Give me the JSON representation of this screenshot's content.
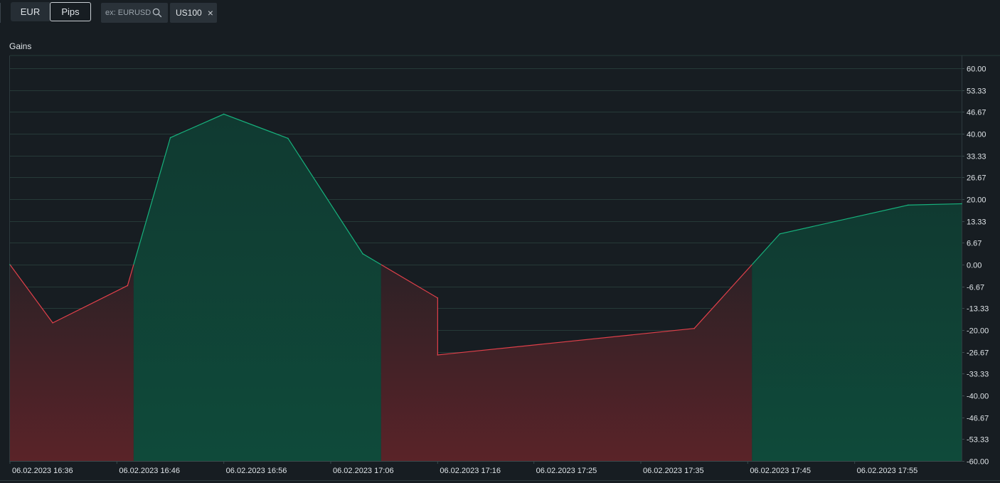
{
  "toolbar": {
    "units": [
      "EUR",
      "Pips"
    ],
    "selected_unit": "Pips",
    "search": {
      "placeholder": "ex: EURUSD",
      "value": ""
    },
    "tag": {
      "label": "US100",
      "close": "×"
    }
  },
  "colors": {
    "background": "#171d22",
    "positive_line": "#17b27d",
    "negative_line": "#e0404a",
    "grid": "#263a38"
  },
  "chart_data": {
    "type": "area",
    "title": "Gains",
    "xlabel": "",
    "ylabel": "",
    "ylim": [
      -60,
      60
    ],
    "y_ticks": [
      "60.00",
      "53.33",
      "46.67",
      "40.00",
      "33.33",
      "26.67",
      "20.00",
      "13.33",
      "6.67",
      "0.00",
      "-6.67",
      "-13.33",
      "-20.00",
      "-26.67",
      "-33.33",
      "-40.00",
      "-46.67",
      "-53.33",
      "-60.00"
    ],
    "x_ticks": [
      "06.02.2023 16:36",
      "06.02.2023 16:46",
      "06.02.2023 16:56",
      "06.02.2023 17:06",
      "06.02.2023 17:16",
      "06.02.2023 17:25",
      "06.02.2023 17:35",
      "06.02.2023 17:45",
      "06.02.2023 17:55"
    ],
    "x_range": [
      "06.02.2023 16:36",
      "06.02.2023 18:05"
    ],
    "grid": true,
    "positive_color": "#17b27d",
    "negative_color": "#e0404a",
    "series": [
      {
        "points": [
          {
            "x": "06.02.2023 16:36",
            "y": 0.0
          },
          {
            "x": "06.02.2023 16:40",
            "y": -17.8
          },
          {
            "x": "06.02.2023 16:47",
            "y": -6.4
          },
          {
            "x": "06.02.2023 16:51",
            "y": 38.8
          },
          {
            "x": "06.02.2023 16:56",
            "y": 46.0
          },
          {
            "x": "06.02.2023 17:02",
            "y": 38.6
          },
          {
            "x": "06.02.2023 17:09",
            "y": 3.3
          },
          {
            "x": "06.02.2023 17:16",
            "y": -10.2
          },
          {
            "x": "06.02.2023 17:16",
            "y": -27.6
          },
          {
            "x": "06.02.2023 17:40",
            "y": -19.5
          },
          {
            "x": "06.02.2023 17:48",
            "y": 9.4
          },
          {
            "x": "06.02.2023 18:00",
            "y": 18.2
          },
          {
            "x": "06.02.2023 18:05",
            "y": 18.6
          }
        ]
      }
    ]
  }
}
